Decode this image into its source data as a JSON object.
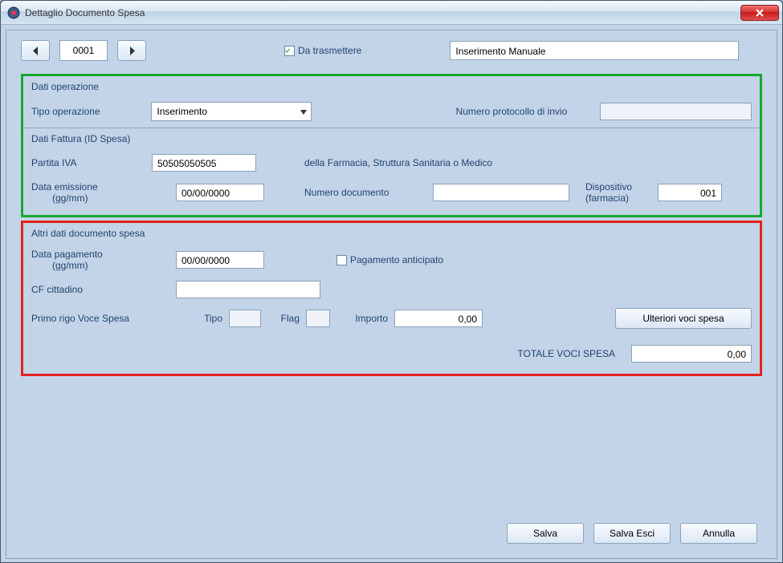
{
  "window": {
    "title": "Dettaglio Documento Spesa"
  },
  "top": {
    "sequence": "0001",
    "transmit_label": "Da trasmettere",
    "transmit_checked": true,
    "mode": "Inserimento Manuale"
  },
  "green": {
    "section1_title": "Dati operazione",
    "tipo_operazione_label": "Tipo operazione",
    "tipo_operazione_value": "Inserimento",
    "numero_protocollo_label": "Numero protocollo di invio",
    "numero_protocollo_value": "",
    "section2_title": "Dati Fattura (ID Spesa)",
    "partita_iva_label": "Partita IVA",
    "partita_iva_value": "50505050505",
    "partita_iva_hint": "della Farmacia, Struttura Sanitaria o Medico",
    "data_emissione_label_l1": "Data emissione",
    "data_emissione_label_l2": "(gg/mm)",
    "data_emissione_value": "00/00/0000",
    "numero_documento_label": "Numero documento",
    "numero_documento_value": "",
    "dispositivo_label_l1": "Dispositivo",
    "dispositivo_label_l2": "(farmacia)",
    "dispositivo_value": "001"
  },
  "red": {
    "section_title": "Altri dati documento spesa",
    "data_pagamento_label_l1": "Data pagamento",
    "data_pagamento_label_l2": "(gg/mm)",
    "data_pagamento_value": "00/00/0000",
    "pagamento_anticipato_label": "Pagamento anticipato",
    "pagamento_anticipato_checked": false,
    "cf_cittadino_label": "CF cittadino",
    "cf_cittadino_value": "",
    "primo_rigo_label": "Primo rigo Voce Spesa",
    "tipo_label": "Tipo",
    "tipo_value": "",
    "flag_label": "Flag",
    "flag_value": "",
    "importo_label": "Importo",
    "importo_value": "0,00",
    "ulteriori_btn": "Ulteriori voci spesa",
    "totale_label": "TOTALE VOCI SPESA",
    "totale_value": "0,00"
  },
  "footer": {
    "salva": "Salva",
    "salva_esci": "Salva Esci",
    "annulla": "Annulla"
  }
}
